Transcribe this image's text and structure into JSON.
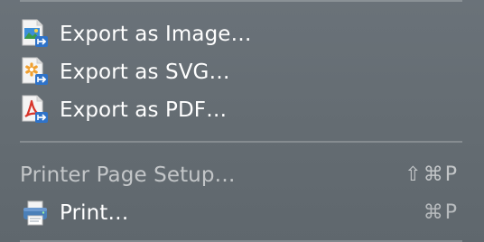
{
  "menu": {
    "items": [
      {
        "label": "Export as Image…",
        "icon": "export-image-icon"
      },
      {
        "label": "Export as SVG…",
        "icon": "export-svg-icon"
      },
      {
        "label": "Export as PDF…",
        "icon": "export-pdf-icon"
      },
      {
        "label": "Printer Page Setup…",
        "shortcut": "⇧⌘P",
        "enabled": false
      },
      {
        "label": "Print…",
        "icon": "printer-icon",
        "shortcut": "⌘P"
      }
    ]
  },
  "colors": {
    "menu_background": "#656d73",
    "text": "#ffffff",
    "svg_asterisk": "#f0a030",
    "pdf_red": "#d8342a",
    "export_badge_blue": "#2f73c9"
  }
}
